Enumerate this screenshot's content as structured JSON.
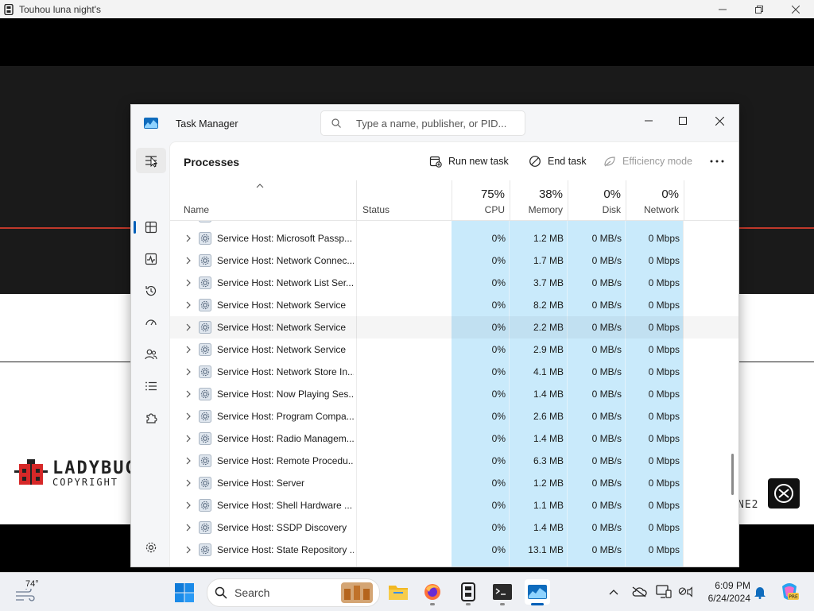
{
  "game_window": {
    "title": "Touhou luna night's"
  },
  "game_art": {
    "logo_line1": "LADYBUG",
    "logo_line2": "COPYRIGHT",
    "partial_text": "NE2"
  },
  "task_manager": {
    "title": "Task Manager",
    "search_placeholder": "Type a name, publisher, or PID...",
    "page_title": "Processes",
    "commands": {
      "run_new_task": "Run new task",
      "end_task": "End task",
      "efficiency_mode": "Efficiency mode"
    },
    "columns": {
      "name": "Name",
      "status": "Status",
      "cpu": {
        "label": "CPU",
        "total": "75%"
      },
      "memory": {
        "label": "Memory",
        "total": "38%"
      },
      "disk": {
        "label": "Disk",
        "total": "0%"
      },
      "network": {
        "label": "Network",
        "total": "0%"
      }
    },
    "rows": [
      {
        "name": "Service Host: Microsoft Passp...",
        "cpu": "0%",
        "memory": "1.2 MB",
        "disk": "0 MB/s",
        "network": "0 Mbps"
      },
      {
        "name": "Service Host: Network Connec...",
        "cpu": "0%",
        "memory": "1.7 MB",
        "disk": "0 MB/s",
        "network": "0 Mbps"
      },
      {
        "name": "Service Host: Network List Ser...",
        "cpu": "0%",
        "memory": "3.7 MB",
        "disk": "0 MB/s",
        "network": "0 Mbps"
      },
      {
        "name": "Service Host: Network Service",
        "cpu": "0%",
        "memory": "8.2 MB",
        "disk": "0 MB/s",
        "network": "0 Mbps"
      },
      {
        "name": "Service Host: Network Service",
        "cpu": "0%",
        "memory": "2.2 MB",
        "disk": "0 MB/s",
        "network": "0 Mbps"
      },
      {
        "name": "Service Host: Network Service",
        "cpu": "0%",
        "memory": "2.9 MB",
        "disk": "0 MB/s",
        "network": "0 Mbps"
      },
      {
        "name": "Service Host: Network Store In...",
        "cpu": "0%",
        "memory": "4.1 MB",
        "disk": "0 MB/s",
        "network": "0 Mbps"
      },
      {
        "name": "Service Host: Now Playing Ses...",
        "cpu": "0%",
        "memory": "1.4 MB",
        "disk": "0 MB/s",
        "network": "0 Mbps"
      },
      {
        "name": "Service Host: Program Compa...",
        "cpu": "0%",
        "memory": "2.6 MB",
        "disk": "0 MB/s",
        "network": "0 Mbps"
      },
      {
        "name": "Service Host: Radio Managem...",
        "cpu": "0%",
        "memory": "1.4 MB",
        "disk": "0 MB/s",
        "network": "0 Mbps"
      },
      {
        "name": "Service Host: Remote Procedu...",
        "cpu": "0%",
        "memory": "6.3 MB",
        "disk": "0 MB/s",
        "network": "0 Mbps"
      },
      {
        "name": "Service Host: Server",
        "cpu": "0%",
        "memory": "1.2 MB",
        "disk": "0 MB/s",
        "network": "0 Mbps"
      },
      {
        "name": "Service Host: Shell Hardware ...",
        "cpu": "0%",
        "memory": "1.1 MB",
        "disk": "0 MB/s",
        "network": "0 Mbps"
      },
      {
        "name": "Service Host: SSDP Discovery",
        "cpu": "0%",
        "memory": "1.4 MB",
        "disk": "0 MB/s",
        "network": "0 Mbps"
      },
      {
        "name": "Service Host: State Repository ...",
        "cpu": "0%",
        "memory": "13.1 MB",
        "disk": "0 MB/s",
        "network": "0 Mbps"
      }
    ]
  },
  "taskbar": {
    "weather_temp": "74°",
    "search_label": "Search",
    "time": "6:09 PM",
    "date": "6/24/2024"
  },
  "colors": {
    "accent": "#005fb8",
    "highlight_column": "#c9eafb",
    "game_red_line": "#c0392b"
  }
}
